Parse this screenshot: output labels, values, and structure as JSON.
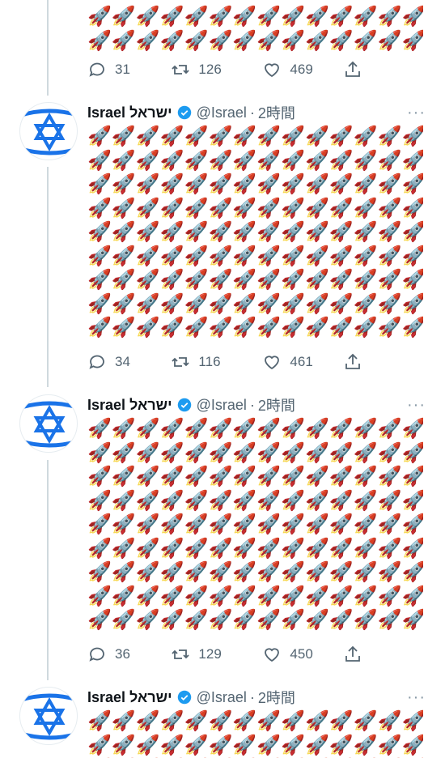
{
  "colors": {
    "verified": "#1d9bf0",
    "icon_grey": "#536471",
    "flag_blue": "#1a73e8",
    "thread_line": "#cfd9de"
  },
  "icons": {
    "avatar": "star-of-david-icon",
    "verified": "verified-badge-icon",
    "more": "more-horizontal-icon",
    "reply": "reply-bubble-icon",
    "retweet": "retweet-icon",
    "like": "heart-icon",
    "share": "share-icon"
  },
  "emoji_char": "🚀",
  "top_partial": {
    "actions": {
      "reply_count": "31",
      "retweet_count": "126",
      "like_count": "469"
    }
  },
  "tweets": [
    {
      "name": "Israel ישראל",
      "handle": "@Israel",
      "separator": "·",
      "time": "2時間",
      "more_label": "···",
      "actions": {
        "reply_count": "34",
        "retweet_count": "116",
        "like_count": "461"
      }
    },
    {
      "name": "Israel ישראל",
      "handle": "@Israel",
      "separator": "·",
      "time": "2時間",
      "more_label": "···",
      "actions": {
        "reply_count": "36",
        "retweet_count": "129",
        "like_count": "450"
      }
    },
    {
      "name": "Israel ישראל",
      "handle": "@Israel",
      "separator": "·",
      "time": "2時間",
      "more_label": "···"
    }
  ]
}
